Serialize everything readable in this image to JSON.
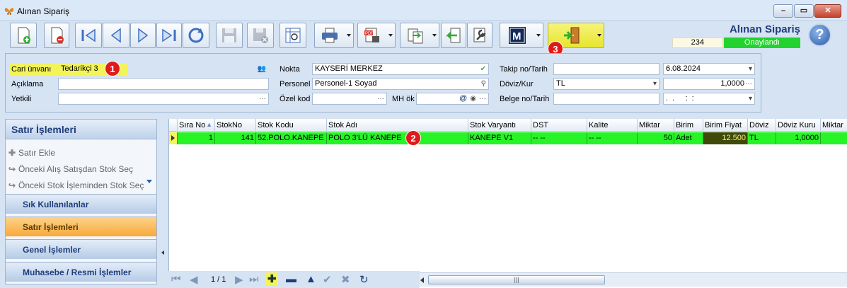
{
  "window": {
    "title": "Alınan Sipariş",
    "icon": "butterfly-icon"
  },
  "header": {
    "title": "Alınan Sipariş",
    "record_no": "234",
    "status": "Onaylandı",
    "status_color": "#22d32f"
  },
  "toolbar": {
    "buttons": [
      {
        "name": "new-document-button",
        "icon": "document-add-icon"
      },
      {
        "name": "delete-document-button",
        "icon": "document-delete-icon"
      },
      {
        "name": "first-record-button",
        "icon": "first-icon"
      },
      {
        "name": "previous-record-button",
        "icon": "previous-icon"
      },
      {
        "name": "next-record-button",
        "icon": "next-icon"
      },
      {
        "name": "last-record-button",
        "icon": "last-icon"
      },
      {
        "name": "refresh-button",
        "icon": "refresh-icon"
      },
      {
        "name": "save-button",
        "icon": "save-icon"
      },
      {
        "name": "save-close-button",
        "icon": "save-cancel-icon"
      },
      {
        "name": "preview-button",
        "icon": "preview-icon"
      },
      {
        "name": "print-button",
        "icon": "printer-icon"
      },
      {
        "name": "export-pdf-button",
        "icon": "pdf-icon"
      },
      {
        "name": "transfer-button",
        "icon": "document-transfer-icon"
      },
      {
        "name": "import-button",
        "icon": "document-import-icon"
      },
      {
        "name": "tools-button",
        "icon": "wrench-icon"
      },
      {
        "name": "m-button",
        "icon": "m-logo-icon",
        "label": "M"
      },
      {
        "name": "exit-button",
        "icon": "exit-door-icon"
      }
    ]
  },
  "form": {
    "cari_unvani": {
      "label": "Cari ünvanı",
      "value": "Tedarikçi 3"
    },
    "aciklama": {
      "label": "Açıklama",
      "value": ""
    },
    "yetkili": {
      "label": "Yetkili",
      "value": "",
      "suffix": "···"
    },
    "nokta": {
      "label": "Nokta",
      "value": "KAYSERİ MERKEZ"
    },
    "personel": {
      "label": "Personel",
      "value": "Personel-1 Soyad"
    },
    "ozel_kod": {
      "label": "Özel kod",
      "value": "",
      "suffix": "···"
    },
    "mh_ok": {
      "label": "MH ök",
      "value": "",
      "suffix": "···"
    },
    "takip_no": {
      "label": "Takip no/Tarih",
      "value": "",
      "date": "6.08.2024"
    },
    "doviz_kur": {
      "label": "Döviz/Kur",
      "value": "TL",
      "rate": "1,0000"
    },
    "belge_no": {
      "label": "Belge no/Tarih",
      "value": "",
      "date": ".  .     :  :"
    },
    "ellipsis": "···"
  },
  "left_panel": {
    "title": "Satır İşlemleri",
    "items": [
      {
        "label": "Satır Ekle",
        "icon": "plus-icon"
      },
      {
        "label": "Önceki Alış Satışdan Stok Seç",
        "icon": "redo-arrow-icon"
      },
      {
        "label": "Önceki Stok İşleminden Stok Seç",
        "icon": "redo-arrow-icon"
      }
    ],
    "tabs": [
      {
        "label": "Sık Kullanılanlar",
        "active": false
      },
      {
        "label": "Satır İşlemleri",
        "active": true
      },
      {
        "label": "Genel İşlemler",
        "active": false
      },
      {
        "label": "Muhasebe / Resmi İşlemler",
        "active": false
      }
    ]
  },
  "grid": {
    "columns": [
      "Sıra No",
      "StokNo",
      "Stok Kodu",
      "Stok Adı",
      "Stok Varyantı",
      "DST",
      "Kalite",
      "Miktar",
      "Birim",
      "Birim Fiyat",
      "Döviz",
      "Döviz Kuru",
      "Miktar"
    ],
    "rows": [
      [
        "1",
        "141",
        "52.POLO.KANEPE",
        "POLO 3'LÜ KANEPE",
        "KANEPE V1",
        "-- --",
        "-- --",
        "50",
        "Adet",
        "12.500",
        "TL",
        "1,0000",
        ""
      ]
    ],
    "row_color": "#27f427"
  },
  "navigator": {
    "page": "1 / 1"
  },
  "markers": [
    "1",
    "2",
    "3"
  ],
  "colors": {
    "accent": "#1f3d7a",
    "highlight": "#f3f35a",
    "active_tab": "#f7a93a"
  }
}
